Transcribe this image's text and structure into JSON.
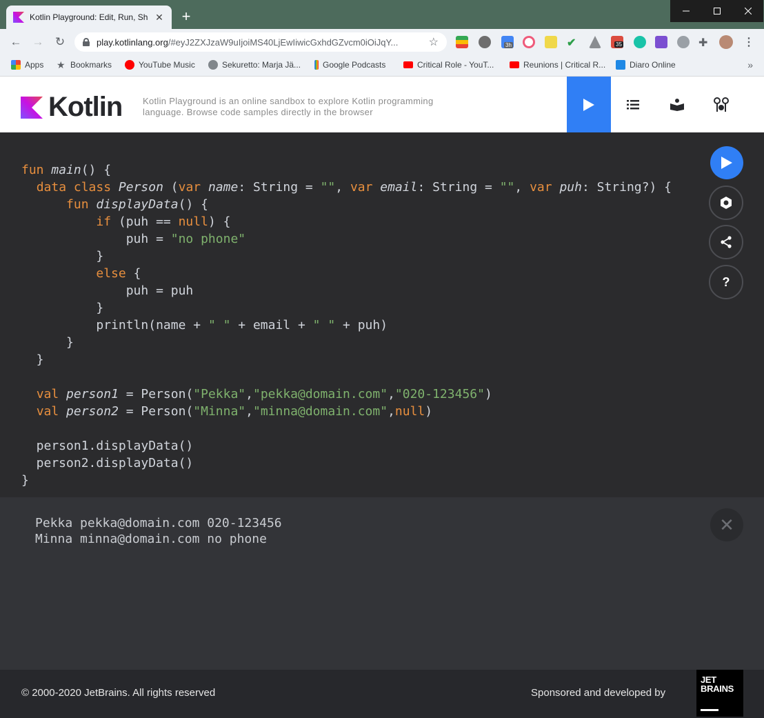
{
  "browser": {
    "tab_title": "Kotlin Playground: Edit, Run, Sha",
    "tab_close": "✕",
    "new_tab": "+",
    "url_host": "play.kotlinlang.org",
    "url_rest": "/#eyJ2ZXJzaW9uIjoiMS40LjEwIiwicGxhdGZvcm0iOiJqY...",
    "ext_badges": {
      "calendar": "3h",
      "todoist": "35"
    },
    "bookmarks": [
      {
        "label": "Apps",
        "icon": "apps-grid-icon",
        "color": "#4285f4"
      },
      {
        "label": "Bookmarks",
        "icon": "star-icon",
        "color": "#5f6368"
      },
      {
        "label": "YouTube Music",
        "icon": "youtube-music-icon",
        "color": "#ff0000"
      },
      {
        "label": "Sekuretto: Marja Jä...",
        "icon": "globe-icon",
        "color": "#5f6368"
      },
      {
        "label": "Google Podcasts",
        "icon": "google-podcasts-icon",
        "color": "#fbbc04"
      },
      {
        "label": "Critical Role - YouT...",
        "icon": "youtube-icon",
        "color": "#ff0000"
      },
      {
        "label": "Reunions | Critical R...",
        "icon": "youtube-icon",
        "color": "#ff0000"
      },
      {
        "label": "Diaro Online",
        "icon": "diaro-icon",
        "color": "#1e88e5"
      }
    ],
    "bookmarks_more": "»"
  },
  "header": {
    "logo_text": "Kotlin",
    "tagline": "Kotlin Playground is an online sandbox to explore Kotlin programming language. Browse code samples directly in the browser",
    "accent": "#307ff5"
  },
  "editor": {
    "code_lines": [
      [
        {
          "t": "fun ",
          "c": "kw"
        },
        {
          "t": "main",
          "c": "fn"
        },
        {
          "t": "() {",
          "c": ""
        }
      ],
      [
        {
          "t": "  ",
          "c": ""
        },
        {
          "t": "data class ",
          "c": "kw"
        },
        {
          "t": "Person",
          "c": "tp"
        },
        {
          "t": " (",
          "c": ""
        },
        {
          "t": "var ",
          "c": "kw"
        },
        {
          "t": "name",
          "c": "fn"
        },
        {
          "t": ": String = ",
          "c": ""
        },
        {
          "t": "\"\"",
          "c": "st"
        },
        {
          "t": ", ",
          "c": ""
        },
        {
          "t": "var ",
          "c": "kw"
        },
        {
          "t": "email",
          "c": "fn"
        },
        {
          "t": ": String = ",
          "c": ""
        },
        {
          "t": "\"\"",
          "c": "st"
        },
        {
          "t": ", ",
          "c": ""
        },
        {
          "t": "var ",
          "c": "kw"
        },
        {
          "t": "puh",
          "c": "fn"
        },
        {
          "t": ": String?) {",
          "c": ""
        }
      ],
      [
        {
          "t": "      ",
          "c": ""
        },
        {
          "t": "fun ",
          "c": "kw"
        },
        {
          "t": "displayData",
          "c": "fn"
        },
        {
          "t": "() {",
          "c": ""
        }
      ],
      [
        {
          "t": "          ",
          "c": ""
        },
        {
          "t": "if ",
          "c": "kw"
        },
        {
          "t": "(puh == ",
          "c": ""
        },
        {
          "t": "null",
          "c": "kw"
        },
        {
          "t": ") {",
          "c": ""
        }
      ],
      [
        {
          "t": "              puh = ",
          "c": ""
        },
        {
          "t": "\"no phone\"",
          "c": "st"
        }
      ],
      [
        {
          "t": "          }",
          "c": ""
        }
      ],
      [
        {
          "t": "          ",
          "c": ""
        },
        {
          "t": "else ",
          "c": "kw"
        },
        {
          "t": "{",
          "c": ""
        }
      ],
      [
        {
          "t": "              puh = puh",
          "c": ""
        }
      ],
      [
        {
          "t": "          }",
          "c": ""
        }
      ],
      [
        {
          "t": "          println(name + ",
          "c": ""
        },
        {
          "t": "\" \"",
          "c": "st"
        },
        {
          "t": " + email + ",
          "c": ""
        },
        {
          "t": "\" \"",
          "c": "st"
        },
        {
          "t": " + puh)",
          "c": ""
        }
      ],
      [
        {
          "t": "      }",
          "c": ""
        }
      ],
      [
        {
          "t": "  }",
          "c": ""
        }
      ],
      [
        {
          "t": "",
          "c": ""
        }
      ],
      [
        {
          "t": "  ",
          "c": ""
        },
        {
          "t": "val ",
          "c": "kw"
        },
        {
          "t": "person1",
          "c": "fn"
        },
        {
          "t": " = Person(",
          "c": ""
        },
        {
          "t": "\"Pekka\"",
          "c": "st"
        },
        {
          "t": ",",
          "c": ""
        },
        {
          "t": "\"pekka@domain.com\"",
          "c": "st"
        },
        {
          "t": ",",
          "c": ""
        },
        {
          "t": "\"020-123456\"",
          "c": "st"
        },
        {
          "t": ")",
          "c": ""
        }
      ],
      [
        {
          "t": "  ",
          "c": ""
        },
        {
          "t": "val ",
          "c": "kw"
        },
        {
          "t": "person2",
          "c": "fn"
        },
        {
          "t": " = Person(",
          "c": ""
        },
        {
          "t": "\"Minna\"",
          "c": "st"
        },
        {
          "t": ",",
          "c": ""
        },
        {
          "t": "\"minna@domain.com\"",
          "c": "st"
        },
        {
          "t": ",",
          "c": ""
        },
        {
          "t": "null",
          "c": "kw"
        },
        {
          "t": ")",
          "c": ""
        }
      ],
      [
        {
          "t": "",
          "c": ""
        }
      ],
      [
        {
          "t": "  person1.displayData()",
          "c": ""
        }
      ],
      [
        {
          "t": "  person2.displayData()",
          "c": ""
        }
      ],
      [
        {
          "t": "}",
          "c": ""
        }
      ]
    ],
    "side_buttons": {
      "help": "?"
    }
  },
  "output": {
    "lines": [
      "Pekka pekka@domain.com 020-123456",
      "Minna minna@domain.com no phone"
    ],
    "close": "✕"
  },
  "footer": {
    "copyright": "© 2000-2020 JetBrains. All rights reserved",
    "sponsor": "Sponsored and developed by",
    "jb_line1": "JET",
    "jb_line2": "BRAINS"
  }
}
